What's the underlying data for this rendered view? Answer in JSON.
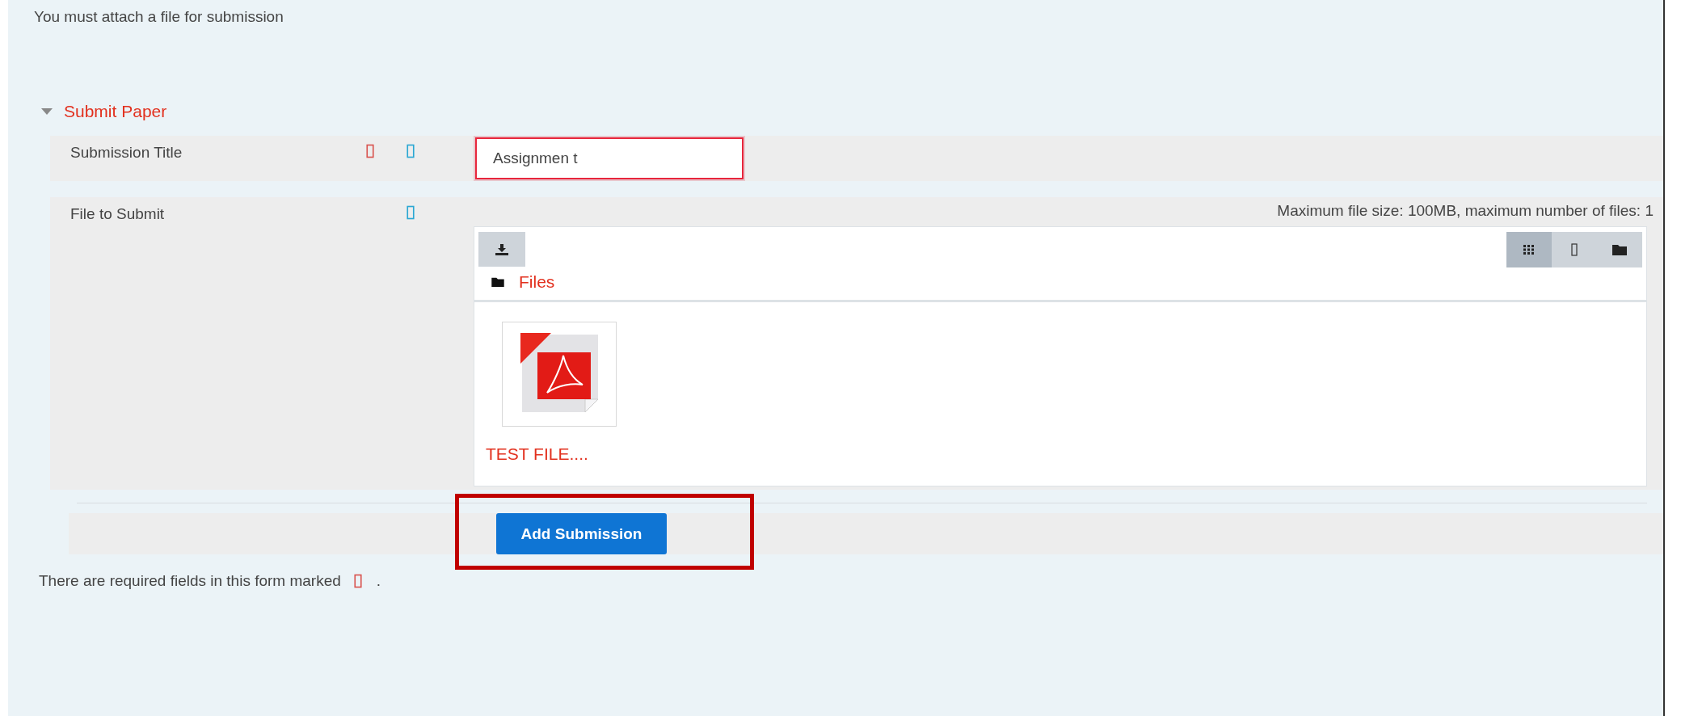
{
  "notice": "You must attach a file for submission",
  "section": {
    "title": "Submit Paper",
    "expanded": true
  },
  "fields": [
    {
      "kind": "text",
      "label": "Submission Title",
      "required": true,
      "help": true,
      "value": "Assignmen t",
      "invalid": true
    },
    {
      "kind": "filepicker",
      "label": "File to Submit",
      "required": false,
      "help": true,
      "limits": "Maximum file size: 100MB, maximum number of files: 1",
      "path": "Files",
      "views": [
        {
          "kind": "icons",
          "selected": true
        },
        {
          "kind": "list",
          "selected": false
        },
        {
          "kind": "tree",
          "selected": false
        }
      ],
      "files": [
        {
          "name": "TEST FILE....",
          "kind": "pdf"
        }
      ]
    }
  ],
  "submit_button": "Add Submission",
  "footer": "There are required fields in this form marked",
  "footer_end": "."
}
